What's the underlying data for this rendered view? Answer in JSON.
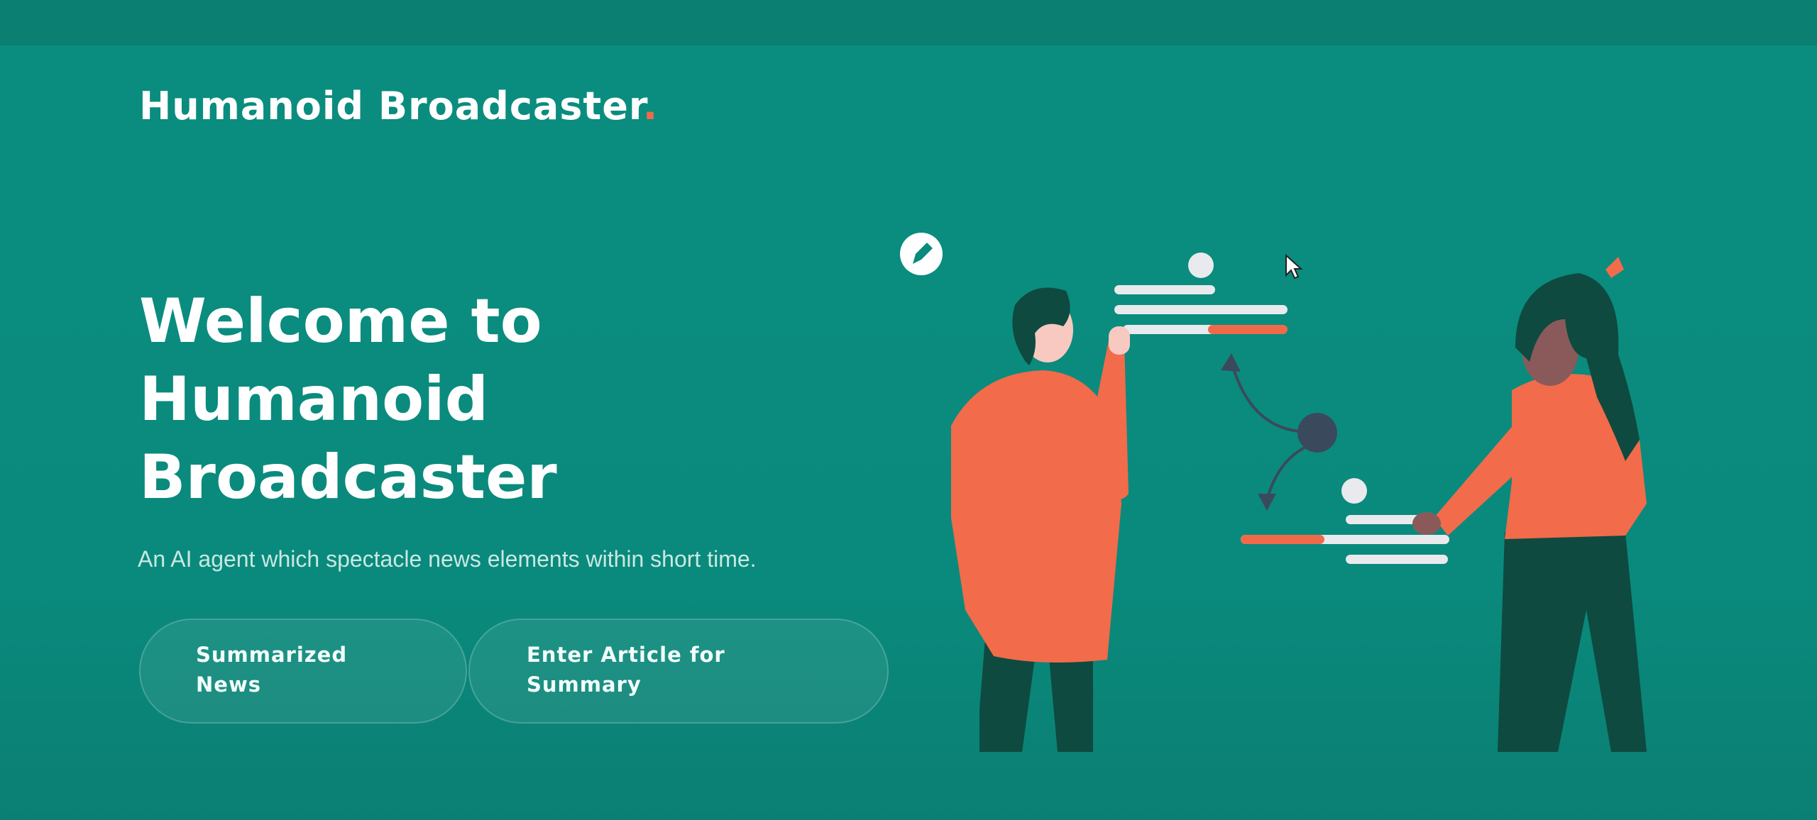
{
  "brand": {
    "name": "Humanoid Broadcaster",
    "dot": "."
  },
  "hero": {
    "title_line1": "Welcome to",
    "title_line2": "Humanoid",
    "title_line3": "Broadcaster",
    "subtitle": "An AI agent which spectacle news elements within short time."
  },
  "buttons": {
    "summarized_news": "Summarized News",
    "enter_article": "Enter Article for Summary"
  },
  "colors": {
    "background": "#0a8a7c",
    "accent": "#f06a4a",
    "dark_figure": "#0e4a3f"
  },
  "icons": {
    "pen_badge": "pen-icon",
    "cursor": "mouse-cursor-icon"
  }
}
